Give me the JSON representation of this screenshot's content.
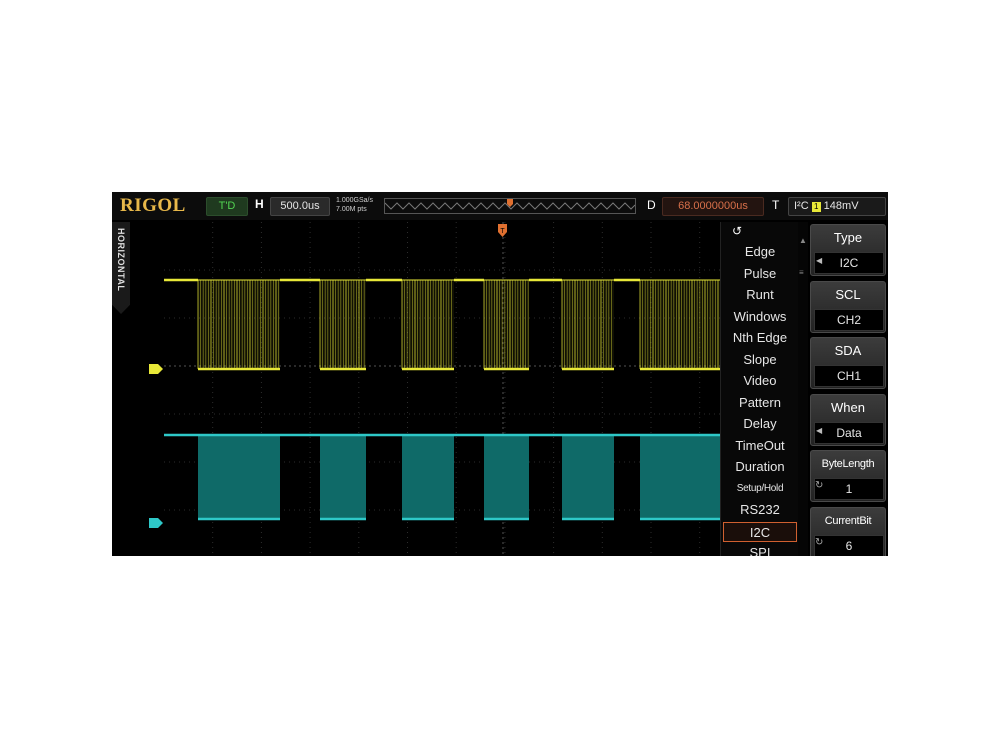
{
  "topbar": {
    "brand": "RIGOL",
    "run_status": "T'D",
    "horizontal_label": "H",
    "timebase": "500.0us",
    "sample_rate_line1": "1.000GSa/s",
    "sample_rate_line2": "7.00M pts",
    "delay_label": "D",
    "delay_value": "68.0000000us",
    "trigger_label": "T",
    "trigger_source": "I²C",
    "trigger_channel": "1",
    "trigger_level": "148mV"
  },
  "side_tab": {
    "label": "HORIZONTAL"
  },
  "trigger_menu": {
    "back_icon": "back-arrow-icon",
    "items": [
      {
        "label": "Edge"
      },
      {
        "label": "Pulse"
      },
      {
        "label": "Runt"
      },
      {
        "label": "Windows"
      },
      {
        "label": "Nth Edge"
      },
      {
        "label": "Slope"
      },
      {
        "label": "Video"
      },
      {
        "label": "Pattern"
      },
      {
        "label": "Delay"
      },
      {
        "label": "TimeOut"
      },
      {
        "label": "Duration"
      },
      {
        "label": "Setup/Hold"
      },
      {
        "label": "RS232"
      },
      {
        "label": "I2C"
      },
      {
        "label": "SPI"
      }
    ],
    "selected": "I2C"
  },
  "softkeys": [
    {
      "label": "Type",
      "value": "I2C"
    },
    {
      "label": "SCL",
      "value": "CH2"
    },
    {
      "label": "SDA",
      "value": "CH1"
    },
    {
      "label": "When",
      "value": "Data"
    },
    {
      "label": "ByteLength",
      "value": "1"
    },
    {
      "label": "CurrentBit",
      "value": "6"
    }
  ],
  "channels": [
    {
      "name": "CH1",
      "marker": "1",
      "color": "#e8e838"
    },
    {
      "name": "CH2",
      "marker": "2",
      "color": "#2ec8c8"
    }
  ],
  "colors": {
    "brand": "#e8b84a",
    "ch1": "#e8e838",
    "ch2": "#2ec8c8",
    "delay": "#d8704a",
    "trigger_marker": "#e07030",
    "menu_selected_border": "#d06030"
  }
}
